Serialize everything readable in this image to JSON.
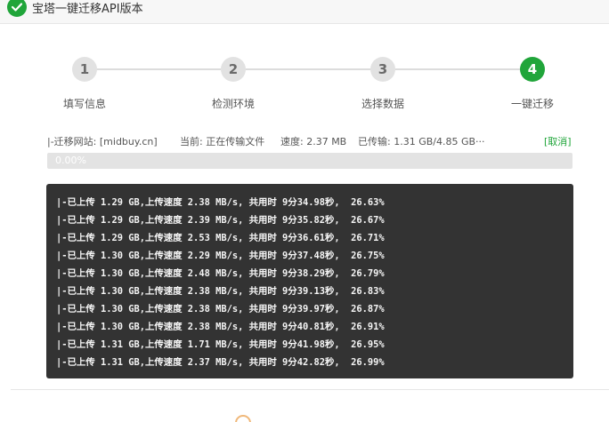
{
  "window": {
    "title": "宝塔一键迁移API版本"
  },
  "steps": [
    {
      "number": "1",
      "label": "填写信息",
      "active": false
    },
    {
      "number": "2",
      "label": "检测环境",
      "active": false
    },
    {
      "number": "3",
      "label": "选择数据",
      "active": false
    },
    {
      "number": "4",
      "label": "一键迁移",
      "active": true
    }
  ],
  "status": {
    "site": "|-迁移网站: [midbuy.cn]",
    "current": "当前: 正在传输文件",
    "speed": "速度: 2.37 MB",
    "transferred": "已传输: 1.31 GB/4.85 GB···",
    "cancel_label": "[取消]"
  },
  "progress": {
    "percent": 0.0,
    "label": "0.00%"
  },
  "log": [
    "|-已上传 1.29 GB,上传速度 2.38 MB/s, 共用时 9分34.98秒,  26.63%",
    "|-已上传 1.29 GB,上传速度 2.39 MB/s, 共用时 9分35.82秒,  26.67%",
    "|-已上传 1.29 GB,上传速度 2.53 MB/s, 共用时 9分36.61秒,  26.71%",
    "|-已上传 1.30 GB,上传速度 2.29 MB/s, 共用时 9分37.48秒,  26.75%",
    "|-已上传 1.30 GB,上传速度 2.48 MB/s, 共用时 9分38.29秒,  26.79%",
    "|-已上传 1.30 GB,上传速度 2.38 MB/s, 共用时 9分39.13秒,  26.83%",
    "|-已上传 1.30 GB,上传速度 2.38 MB/s, 共用时 9分39.97秒,  26.87%",
    "|-已上传 1.30 GB,上传速度 2.38 MB/s, 共用时 9分40.81秒,  26.91%",
    "|-已上传 1.31 GB,上传速度 1.71 MB/s, 共用时 9分41.98秒,  26.95%",
    "|-已上传 1.31 GB,上传速度 2.37 MB/s, 共用时 9分42.82秒,  26.99%"
  ],
  "colors": {
    "accent": "#20a53a",
    "console_bg": "#333333",
    "step_inactive": "#e2e2e2"
  },
  "icons": {
    "title_icon": "check-circle-icon"
  }
}
